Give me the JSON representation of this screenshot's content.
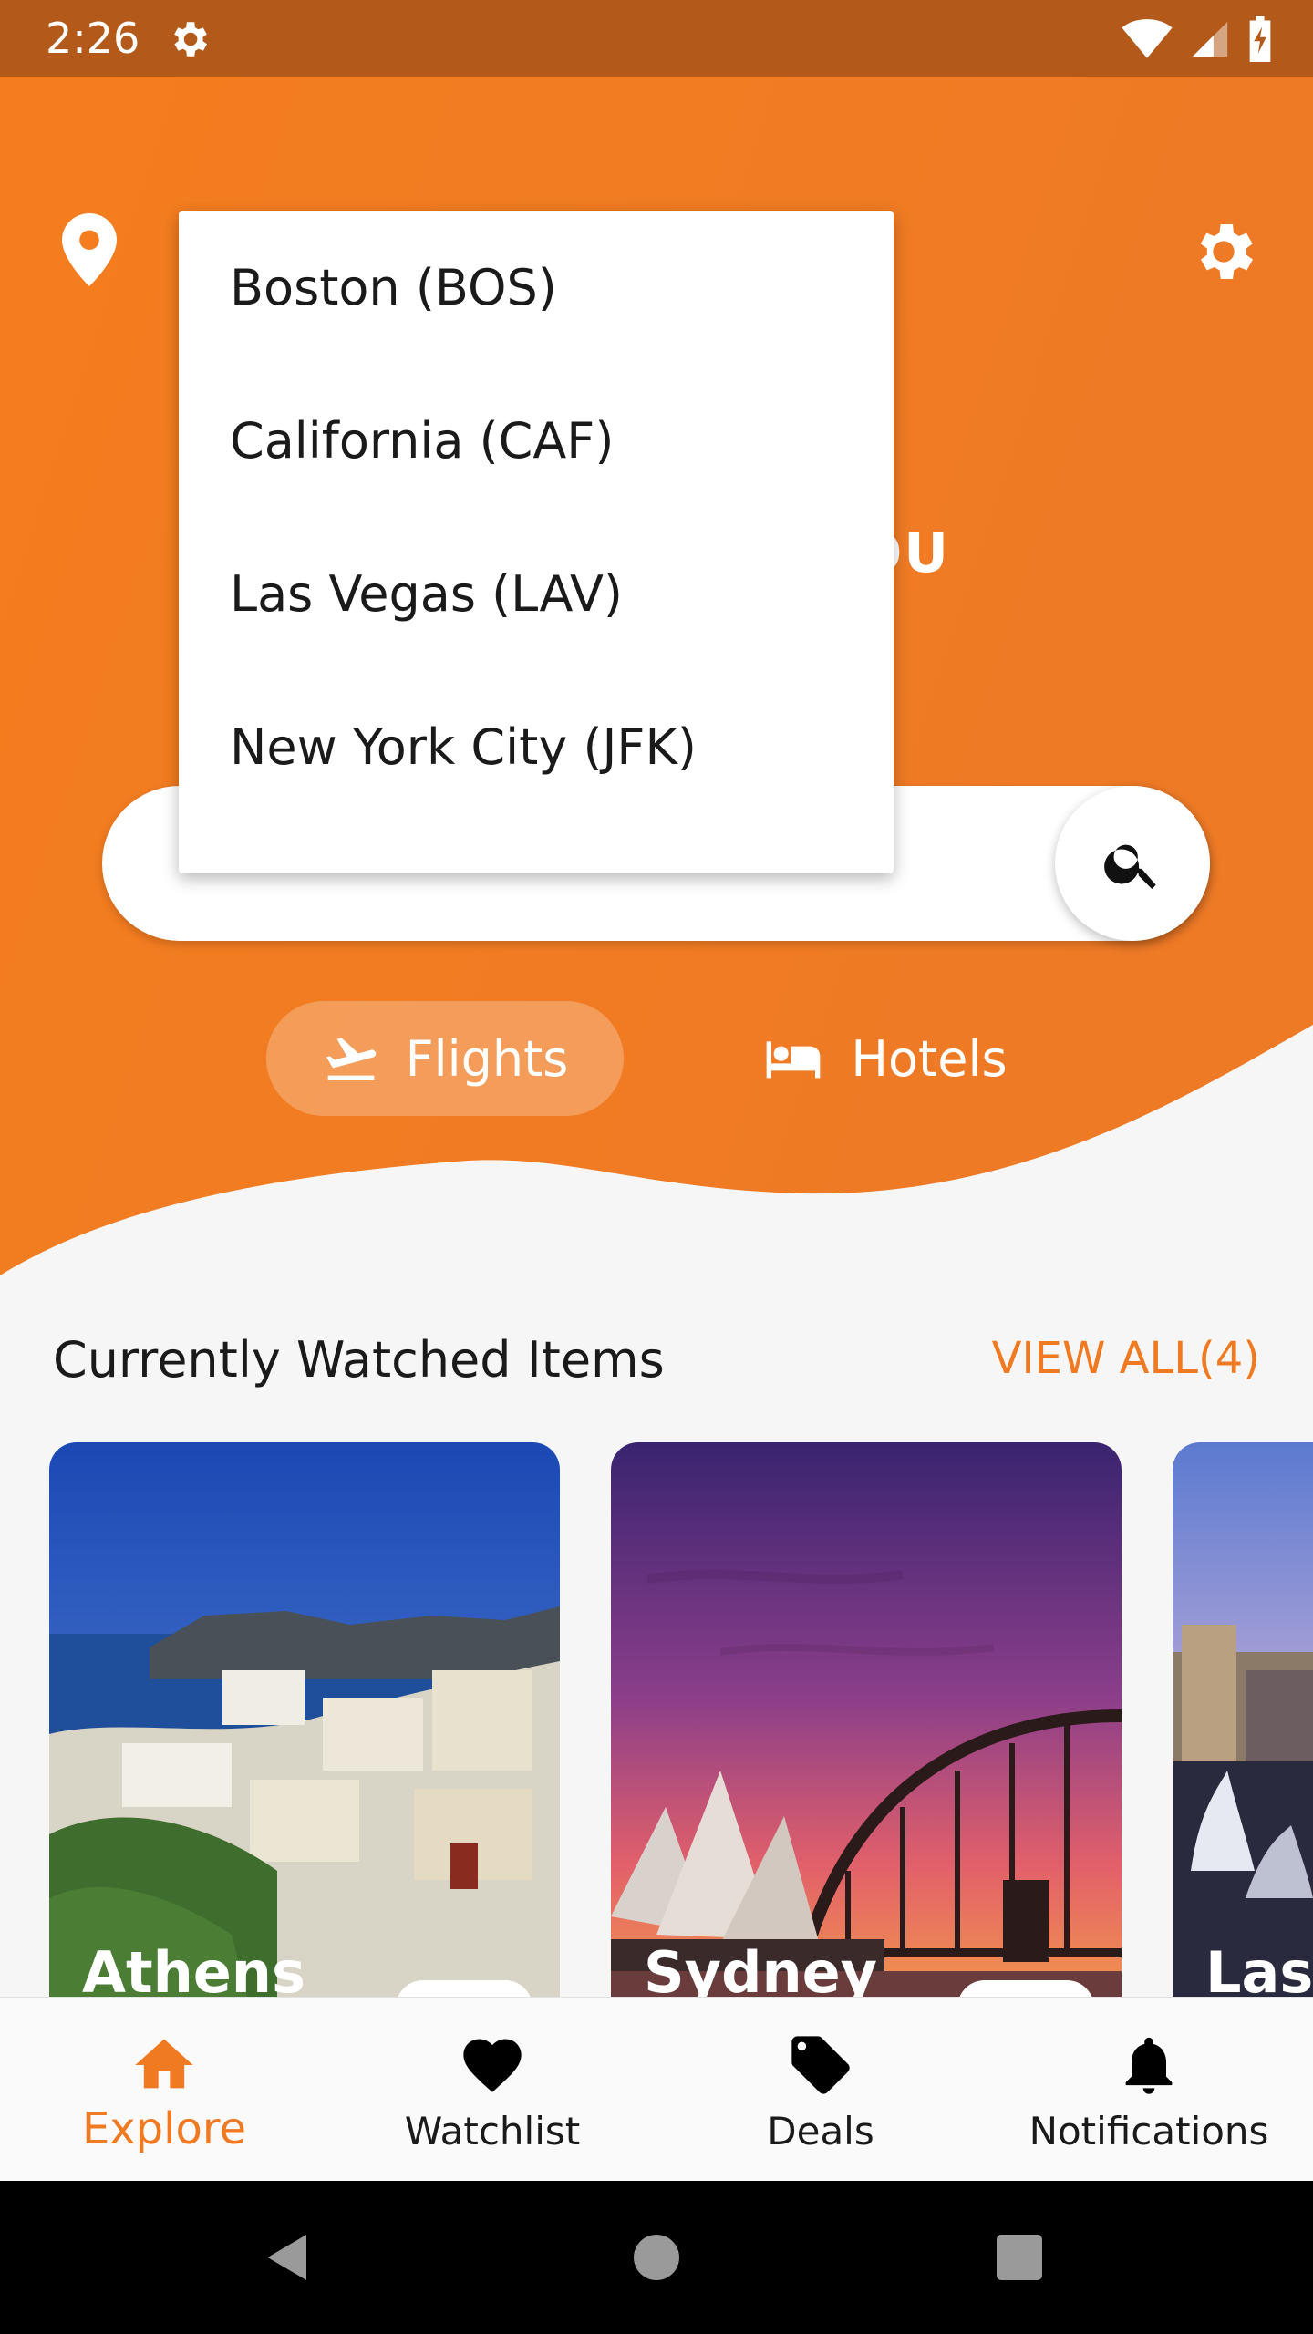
{
  "status": {
    "time": "2:26"
  },
  "hero": {
    "heading": "OU"
  },
  "location_dropdown": {
    "items": [
      "Boston (BOS)",
      "California (CAF)",
      "Las Vegas (LAV)",
      "New York City (JFK)"
    ]
  },
  "tabs": {
    "flights": "Flights",
    "hotels": "Hotels",
    "active": "Flights"
  },
  "watched": {
    "title": "Currently Watched Items",
    "view_all": "VIEW ALL(4)",
    "cards": [
      {
        "name": "Athens"
      },
      {
        "name": "Sydney"
      },
      {
        "name": "Las V"
      }
    ]
  },
  "bottom_nav": {
    "active": "Explore",
    "items": [
      {
        "label": "Explore",
        "icon": "home-icon"
      },
      {
        "label": "Watchlist",
        "icon": "heart-icon"
      },
      {
        "label": "Deals",
        "icon": "tag-icon"
      },
      {
        "label": "Notifications",
        "icon": "bell-icon"
      }
    ]
  },
  "colors": {
    "accent": "#f07a22",
    "status_bar": "#b35a1a"
  }
}
